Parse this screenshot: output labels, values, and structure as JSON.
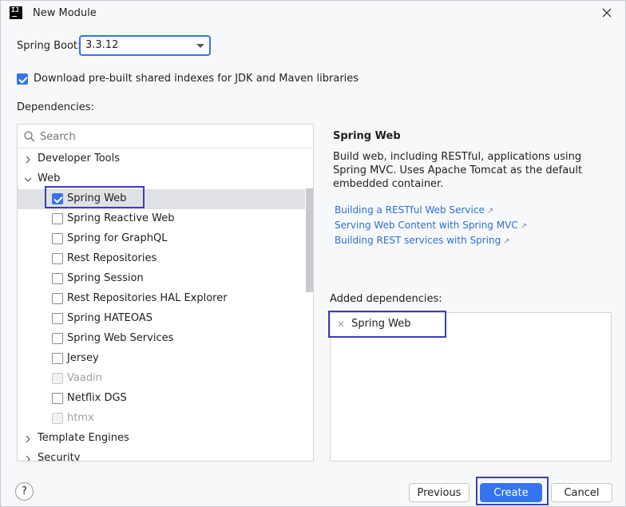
{
  "window": {
    "title": "New Module"
  },
  "spring_boot": {
    "label": "Spring Boot:",
    "value": "3.3.12"
  },
  "download_indexes": {
    "label": "Download pre-built shared indexes for JDK and Maven libraries",
    "checked": true
  },
  "dependencies": {
    "label": "Dependencies:",
    "search_placeholder": "Search",
    "groups": [
      {
        "label": "Developer Tools",
        "expanded": false
      },
      {
        "label": "Web",
        "expanded": true
      },
      {
        "label": "Template Engines",
        "expanded": false
      },
      {
        "label": "Security",
        "expanded": false
      }
    ],
    "web_items": [
      {
        "label": "Spring Web",
        "checked": true,
        "disabled": false
      },
      {
        "label": "Spring Reactive Web",
        "checked": false,
        "disabled": false
      },
      {
        "label": "Spring for GraphQL",
        "checked": false,
        "disabled": false
      },
      {
        "label": "Rest Repositories",
        "checked": false,
        "disabled": false
      },
      {
        "label": "Spring Session",
        "checked": false,
        "disabled": false
      },
      {
        "label": "Rest Repositories HAL Explorer",
        "checked": false,
        "disabled": false
      },
      {
        "label": "Spring HATEOAS",
        "checked": false,
        "disabled": false
      },
      {
        "label": "Spring Web Services",
        "checked": false,
        "disabled": false
      },
      {
        "label": "Jersey",
        "checked": false,
        "disabled": false
      },
      {
        "label": "Vaadin",
        "checked": false,
        "disabled": true
      },
      {
        "label": "Netflix DGS",
        "checked": false,
        "disabled": false
      },
      {
        "label": "htmx",
        "checked": false,
        "disabled": true
      }
    ]
  },
  "info": {
    "title": "Spring Web",
    "description": "Build web, including RESTful, applications using Spring MVC. Uses Apache Tomcat as the default embedded container.",
    "links": [
      "Building a RESTful Web Service",
      "Serving Web Content with Spring MVC",
      "Building REST services with Spring"
    ]
  },
  "added": {
    "label": "Added dependencies:",
    "items": [
      "Spring Web"
    ]
  },
  "footer": {
    "help": "?",
    "previous": "Previous",
    "create": "Create",
    "cancel": "Cancel"
  },
  "colors": {
    "accent": "#3574f0",
    "highlight_box": "#3d3eb5",
    "link": "#2f6fd1"
  }
}
